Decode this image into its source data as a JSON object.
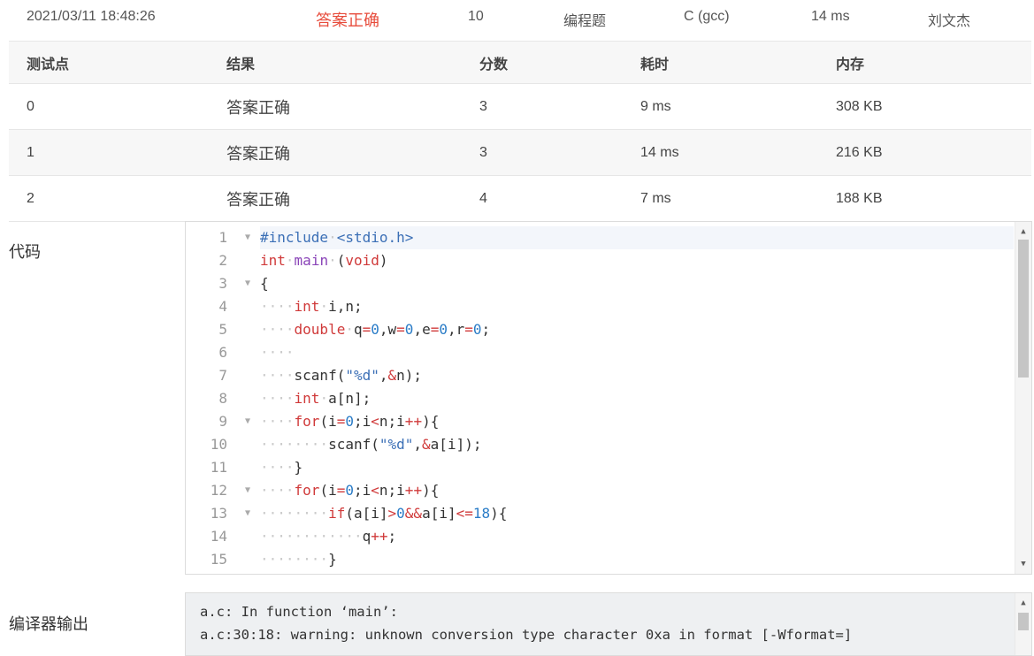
{
  "submission": {
    "time": "2021/03/11 18:48:26",
    "status": "答案正确",
    "score": "10",
    "type": "编程题",
    "compiler": "C (gcc)",
    "runtime": "14 ms",
    "user": "刘文杰"
  },
  "results_table": {
    "headers": [
      "测试点",
      "结果",
      "分数",
      "耗时",
      "内存"
    ],
    "rows": [
      {
        "case": "0",
        "result": "答案正确",
        "score": "3",
        "time": "9 ms",
        "memory": "308 KB"
      },
      {
        "case": "1",
        "result": "答案正确",
        "score": "3",
        "time": "14 ms",
        "memory": "216 KB"
      },
      {
        "case": "2",
        "result": "答案正确",
        "score": "4",
        "time": "7 ms",
        "memory": "188 KB"
      }
    ]
  },
  "code_section": {
    "label": "代码",
    "line_numbers": [
      "1",
      "2",
      "3",
      "4",
      "5",
      "6",
      "7",
      "8",
      "9",
      "10",
      "11",
      "12",
      "13",
      "14",
      "15"
    ],
    "foldable_lines": [
      "1",
      "3",
      "9",
      "12",
      "13"
    ],
    "lines": [
      "#include <stdio.h>",
      "int main (void)",
      "{",
      "    int i,n;",
      "    double q=0,w=0,e=0,r=0;",
      "    ",
      "    scanf(\"%d\",&n);",
      "    int a[n];",
      "    for(i=0;i<n;i++){",
      "        scanf(\"%d\",&a[i]);",
      "    }",
      "    for(i=0;i<n;i++){",
      "        if(a[i]>0&&a[i]<=18){",
      "            q++;",
      "        }"
    ]
  },
  "compiler_output": {
    "label": "编译器输出",
    "lines": [
      "a.c: In function ‘main’:",
      "a.c:30:18: warning: unknown conversion type character 0xa in format [-Wformat=]"
    ]
  },
  "icons": {
    "fold": "fold-triangle-icon",
    "scroll_up": "scroll-up-arrow-icon",
    "scroll_down": "scroll-down-arrow-icon"
  },
  "colors": {
    "accepted": "#e74c3c",
    "keyword": "#d03a3a",
    "string": "#3b6fb6",
    "number": "#2a7cc7",
    "function": "#8a44b8",
    "whitespace_dot": "#c8c8c8"
  }
}
